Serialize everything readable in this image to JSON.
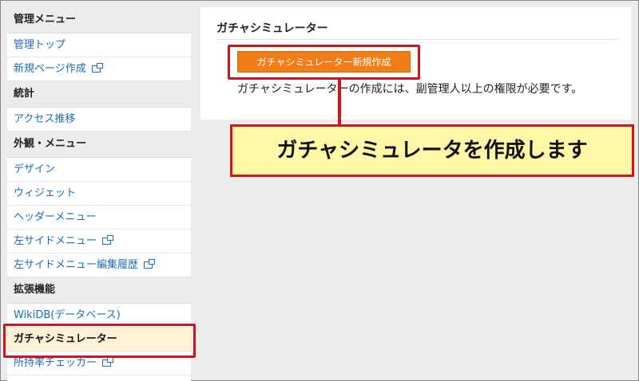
{
  "sidebar": {
    "sections": [
      {
        "heading": "管理メニュー",
        "items": [
          {
            "label": "管理トップ",
            "external": false
          },
          {
            "label": "新規ページ作成",
            "external": true
          }
        ]
      },
      {
        "heading": "統計",
        "items": [
          {
            "label": "アクセス推移",
            "external": false
          }
        ]
      },
      {
        "heading": "外観・メニュー",
        "items": [
          {
            "label": "デザイン",
            "external": false
          },
          {
            "label": "ウィジェット",
            "external": false
          },
          {
            "label": "ヘッダーメニュー",
            "external": false
          },
          {
            "label": "左サイドメニュー",
            "external": true
          },
          {
            "label": "左サイドメニュー編集履歴",
            "external": true
          }
        ]
      },
      {
        "heading": "拡張機能",
        "items": [
          {
            "label": "WikiDB(データベース)",
            "external": false
          },
          {
            "label": "ガチャシミュレーター",
            "external": false,
            "active": true
          },
          {
            "label": "所持率チェッカー",
            "external": true
          }
        ]
      }
    ]
  },
  "main": {
    "title": "ガチャシミュレーター",
    "create_button": "ガチャシミュレーター新規作成",
    "notice": "ガチャシミュレーターの作成には、副管理人以上の権限が必要です。"
  },
  "callout": {
    "text": "ガチャシミュレータを作成します"
  },
  "colors": {
    "accent_orange": "#f07d18",
    "highlight_red": "#c8181e",
    "callout_bg": "#fff7a6",
    "link_blue": "#1b6db5",
    "active_bg": "#fdf2d6"
  }
}
